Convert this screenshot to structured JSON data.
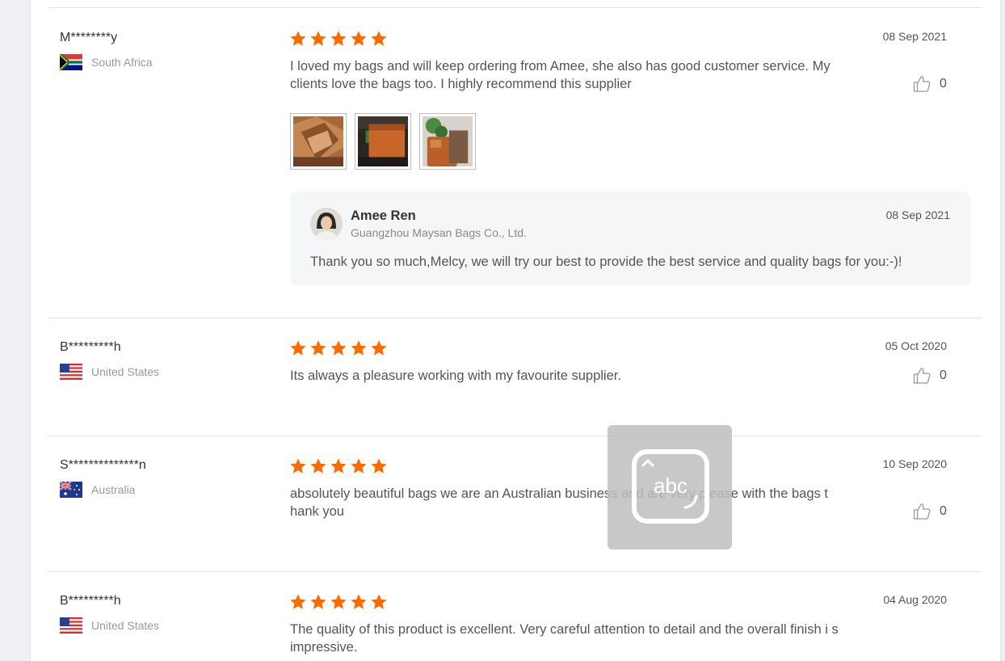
{
  "reviews": [
    {
      "name": "M********y",
      "country": "South Africa",
      "flag_icon": "south-africa-flag-icon",
      "rating": 5,
      "date": "08 Sep 2021",
      "text": "I loved my bags and will keep ordering from Amee, she also has good customer service. My clients love the bags too. I highly recommend this supplier",
      "likes": "0",
      "images": [
        "bag-photo-1",
        "bag-photo-2",
        "bag-photo-3"
      ],
      "reply": {
        "name": "Amee Ren",
        "company": "Guangzhou Maysan Bags Co., Ltd.",
        "date": "08 Sep 2021",
        "text": "Thank you so much,Melcy, we will try our best to provide the best service and quality bags for you:-)!"
      }
    },
    {
      "name": "B*********h",
      "country": "United States",
      "flag_icon": "us-flag-icon",
      "rating": 5,
      "date": "05 Oct 2020",
      "text": "Its always a pleasure working with my favourite supplier.",
      "likes": "0"
    },
    {
      "name": "S**************n",
      "country": "Australia",
      "flag_icon": "australia-flag-icon",
      "rating": 5,
      "date": "10 Sep 2020",
      "text": "absolutely beautiful bags we are an Australian business and are very please with the bags t hank you",
      "likes": "0"
    },
    {
      "name": "B*********h",
      "country": "United States",
      "flag_icon": "us-flag-icon",
      "rating": 5,
      "date": "04 Aug 2020",
      "text": "The quality of this product is excellent. Very careful attention to detail and the overall finish i s impressive.",
      "likes": "0"
    }
  ],
  "overlay": {
    "icon": "keyboard-abc-icon",
    "label": "abc"
  },
  "colors": {
    "star": "#ff6a00",
    "divider": "#e3e3e3",
    "reply_bg": "#f5f6f8"
  }
}
